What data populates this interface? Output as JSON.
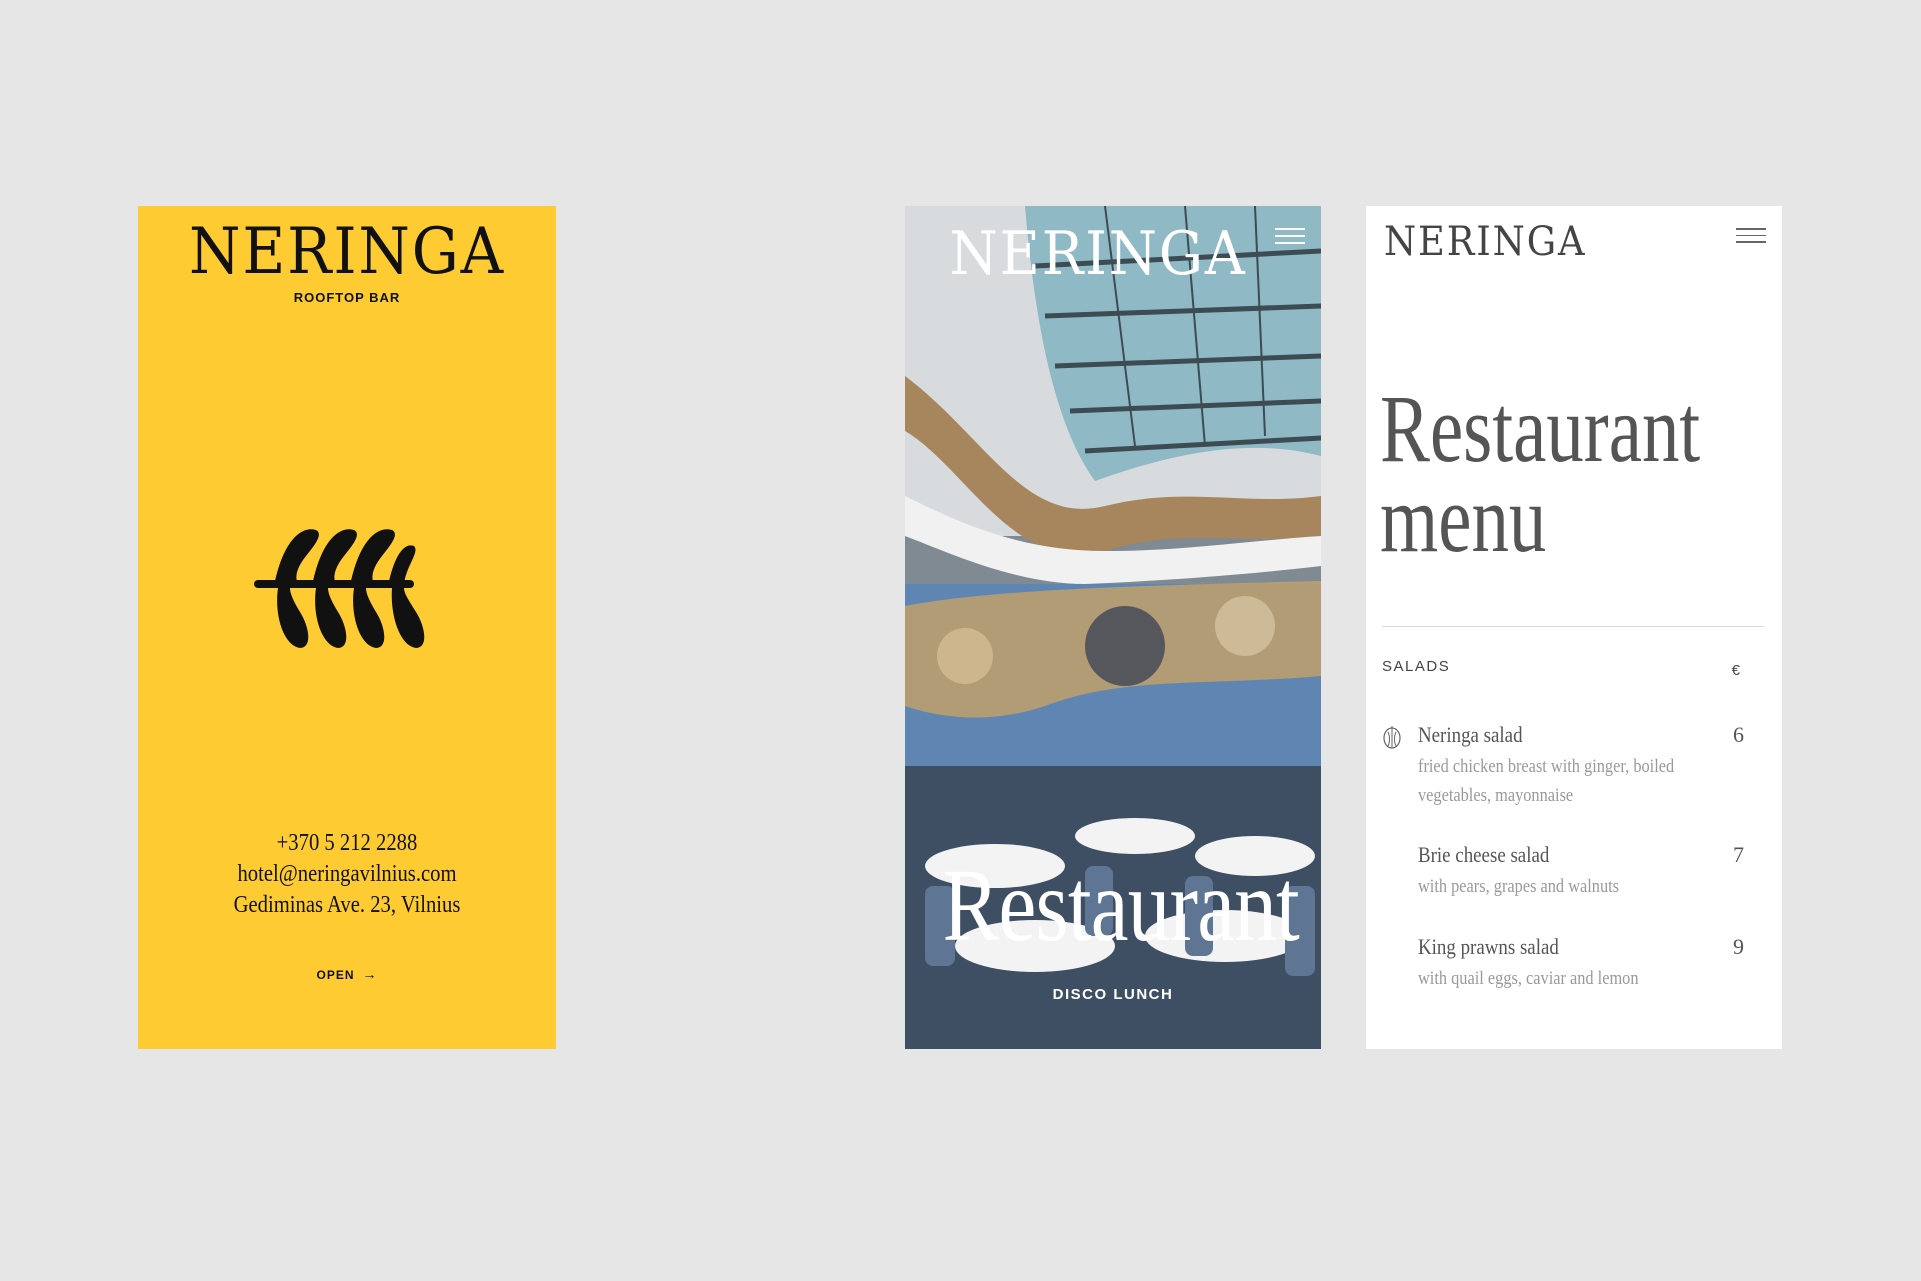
{
  "bar_card": {
    "logo": "Neringa",
    "subtitle": "ROOFTOP BAR",
    "emblem_icon": "wheat-ear-emblem-icon",
    "phone": "+370 5 212 2288",
    "email": "hotel@neringavilnius.com",
    "address": "Gediminas Ave. 23, Vilnius",
    "open_label": "OPEN",
    "open_icon": "arrow-right-icon",
    "background": "#fecb32"
  },
  "restaurant_card": {
    "logo": "Neringa",
    "menu_icon": "hamburger-menu-icon",
    "title": "Restaurant",
    "subtitle": "DISCO LUNCH"
  },
  "menu_card": {
    "logo": "Neringa",
    "menu_icon": "hamburger-menu-icon",
    "title_line1": "Restaurant",
    "title_line2": "menu",
    "section": "SALADS",
    "currency": "€",
    "dishes": [
      {
        "name": "Neringa salad",
        "desc": "fried chicken breast with ginger, boiled vegetables, mayonnaise",
        "price": "6",
        "icon": "signature-dish-icon"
      },
      {
        "name": "Brie cheese salad",
        "desc": "with pears, grapes and walnuts",
        "price": "7"
      },
      {
        "name": "King prawns salad",
        "desc": "with quail eggs, caviar and lemon",
        "price": "9"
      }
    ]
  }
}
